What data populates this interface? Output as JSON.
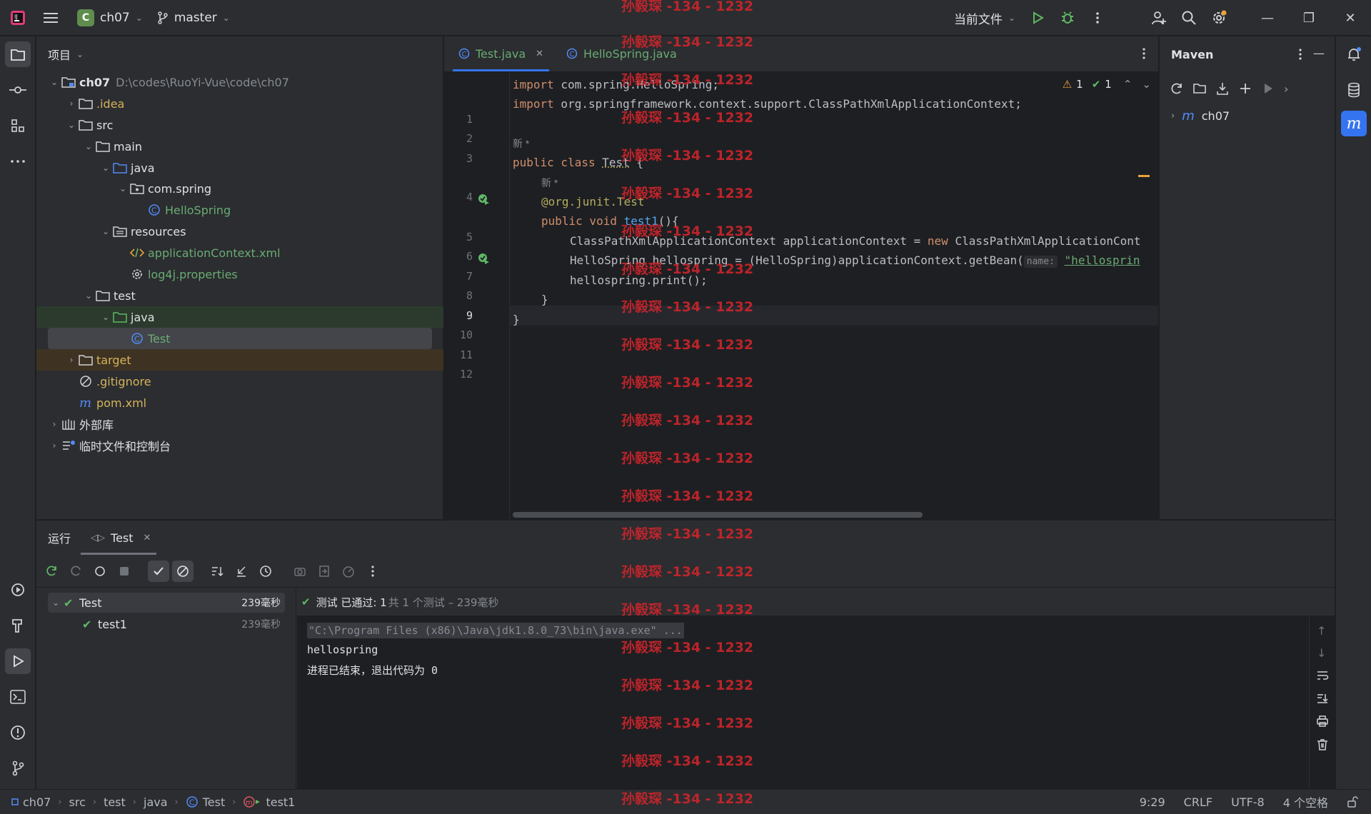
{
  "titlebar": {
    "project_letter": "C",
    "project_name": "ch07",
    "branch": "master",
    "run_config": "当前文件"
  },
  "project_panel": {
    "title": "项目",
    "tree": [
      {
        "label": "ch07",
        "path": "D:\\codes\\RuoYi-Vue\\code\\ch07",
        "depth": 0,
        "arrow": "⌄",
        "icon": "module-folder-icon",
        "color": "#dfe1e5",
        "bold": true
      },
      {
        "label": ".idea",
        "depth": 1,
        "arrow": "›",
        "icon": "folder-icon",
        "color": "#d6b35c"
      },
      {
        "label": "src",
        "depth": 1,
        "arrow": "⌄",
        "icon": "folder-icon",
        "color": "#dfe1e5"
      },
      {
        "label": "main",
        "depth": 2,
        "arrow": "⌄",
        "icon": "folder-icon",
        "color": "#dfe1e5"
      },
      {
        "label": "java",
        "depth": 3,
        "arrow": "⌄",
        "icon": "source-folder-icon",
        "color": "#dfe1e5"
      },
      {
        "label": "com.spring",
        "depth": 4,
        "arrow": "⌄",
        "icon": "package-icon",
        "color": "#dfe1e5"
      },
      {
        "label": "HelloSpring",
        "depth": 5,
        "arrow": "",
        "icon": "class-icon",
        "color": "#6aab73"
      },
      {
        "label": "resources",
        "depth": 3,
        "arrow": "⌄",
        "icon": "resources-folder-icon",
        "color": "#dfe1e5"
      },
      {
        "label": "applicationContext.xml",
        "depth": 4,
        "arrow": "",
        "icon": "xml-file-icon",
        "color": "#6aab73"
      },
      {
        "label": "log4j.properties",
        "depth": 4,
        "arrow": "",
        "icon": "properties-file-icon",
        "color": "#6aab73"
      },
      {
        "label": "test",
        "depth": 2,
        "arrow": "⌄",
        "icon": "folder-icon",
        "color": "#dfe1e5"
      },
      {
        "label": "java",
        "depth": 3,
        "arrow": "⌄",
        "icon": "test-folder-icon",
        "color": "#dfe1e5"
      },
      {
        "label": "Test",
        "depth": 4,
        "arrow": "",
        "icon": "class-icon",
        "color": "#6aab73"
      },
      {
        "label": "target",
        "depth": 1,
        "arrow": "›",
        "icon": "folder-icon",
        "color": "#d6b35c"
      },
      {
        "label": ".gitignore",
        "depth": 1,
        "arrow": "",
        "icon": "ignore-file-icon",
        "color": "#d6b35c"
      },
      {
        "label": "pom.xml",
        "depth": 1,
        "arrow": "",
        "icon": "maven-file-icon",
        "color": "#d6b35c"
      },
      {
        "label": "外部库",
        "depth": 0,
        "arrow": "›",
        "icon": "library-icon",
        "color": "#dfe1e5"
      },
      {
        "label": "临时文件和控制台",
        "depth": 0,
        "arrow": "›",
        "icon": "scratch-icon",
        "color": "#dfe1e5"
      }
    ]
  },
  "editor": {
    "tabs": [
      {
        "label": "Test.java",
        "active": true
      },
      {
        "label": "HelloSpring.java",
        "active": false
      }
    ],
    "inspections": {
      "warnings": "1",
      "ok": "1"
    },
    "lines": [
      {
        "n": "1"
      },
      {
        "n": "2"
      },
      {
        "n": "3"
      },
      {
        "n": "4"
      },
      {
        "n": "5"
      },
      {
        "n": "6"
      },
      {
        "n": "7"
      },
      {
        "n": "8"
      },
      {
        "n": "9"
      },
      {
        "n": "10"
      },
      {
        "n": "11"
      },
      {
        "n": "12"
      }
    ],
    "code": {
      "l1_kw": "import",
      "l1_rest": " com.spring.HelloSpring;",
      "l2_kw": "import",
      "l2_rest": " org.springframework.context.support.ClassPathXmlApplicationContext;",
      "hint_new": "新 *",
      "l4_kw": "public class",
      "l4_name": "Test",
      "l4_rest": " {",
      "l5_ann": "@org.junit.Test",
      "l6_kw": "public void",
      "l6_fn": "test1",
      "l6_rest": "(){",
      "l7_a": "ClassPathXmlApplicationContext applicationContext = ",
      "l7_kw": "new",
      "l7_b": " ClassPathXmlApplicationCont",
      "l8_a": "HelloSpring hellospring = (HelloSpring)applicationContext.getBean(",
      "l8_hint": "name:",
      "l8_str": "\"hellosprin",
      "l9": "hellospring.print();",
      "l10": "}",
      "l11": "}"
    }
  },
  "maven": {
    "title": "Maven",
    "root": "ch07"
  },
  "run_panel": {
    "tab_run": "运行",
    "tab_test": "Test",
    "tree": [
      {
        "label": "Test",
        "time": "239毫秒"
      },
      {
        "label": "test1",
        "time": "239毫秒"
      }
    ],
    "status_passed": "测试 已通过: 1",
    "status_detail": "共 1 个测试 – 239毫秒",
    "console": [
      "\"C:\\Program Files (x86)\\Java\\jdk1.8.0_73\\bin\\java.exe\" ...",
      "hellospring",
      "进程已结束，退出代码为 0"
    ]
  },
  "statusbar": {
    "breadcrumbs": [
      "ch07",
      "src",
      "test",
      "java",
      "Test",
      "test1"
    ],
    "position": "9:29",
    "line_sep": "CRLF",
    "encoding": "UTF-8",
    "indent": "4 个空格"
  },
  "watermark": "孙毅琛 -134 - 1232",
  "colors": {
    "accent": "#3574f0",
    "green": "#5fb865",
    "watermark": "#c9252b"
  }
}
